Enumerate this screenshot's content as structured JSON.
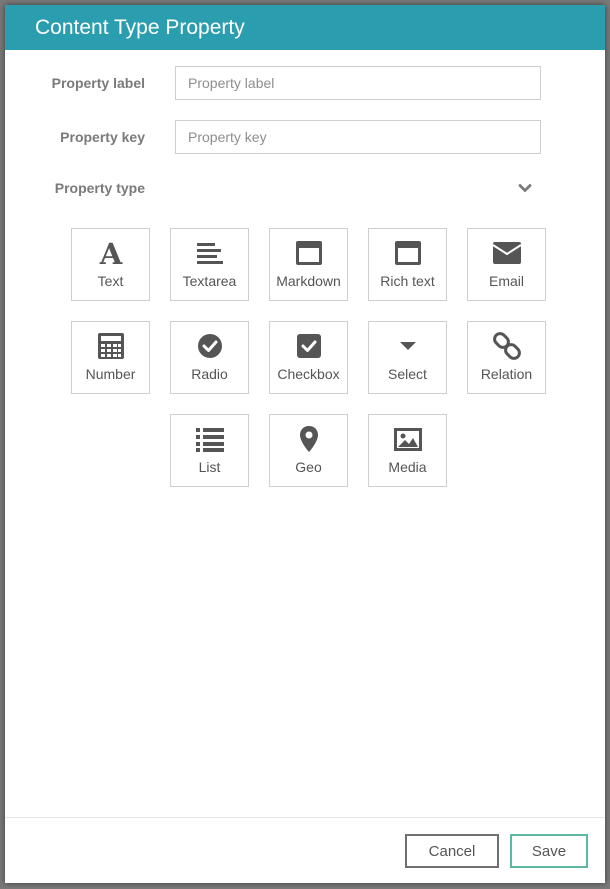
{
  "dialog": {
    "title": "Content Type Property"
  },
  "form": {
    "label_field": {
      "label": "Property label",
      "placeholder": "Property label",
      "value": ""
    },
    "key_field": {
      "label": "Property key",
      "placeholder": "Property key",
      "value": ""
    },
    "type_label": "Property type",
    "type_toggle_icon": "chevron-down-icon"
  },
  "types": [
    {
      "label": "Text",
      "icon": "text-icon"
    },
    {
      "label": "Textarea",
      "icon": "textarea-icon"
    },
    {
      "label": "Markdown",
      "icon": "markdown-icon"
    },
    {
      "label": "Rich text",
      "icon": "rich-text-icon"
    },
    {
      "label": "Email",
      "icon": "envelope-icon"
    },
    {
      "label": "Number",
      "icon": "calculator-icon"
    },
    {
      "label": "Radio",
      "icon": "radio-check-icon"
    },
    {
      "label": "Checkbox",
      "icon": "checkbox-icon"
    },
    {
      "label": "Select",
      "icon": "caret-down-icon"
    },
    {
      "label": "Relation",
      "icon": "link-icon"
    },
    {
      "label": "List",
      "icon": "list-icon"
    },
    {
      "label": "Geo",
      "icon": "map-marker-icon"
    },
    {
      "label": "Media",
      "icon": "image-icon"
    }
  ],
  "footer": {
    "cancel_label": "Cancel",
    "save_label": "Save"
  },
  "colors": {
    "header": "#2a9daf",
    "icon": "#555555",
    "save_border": "#5cb8a2"
  }
}
